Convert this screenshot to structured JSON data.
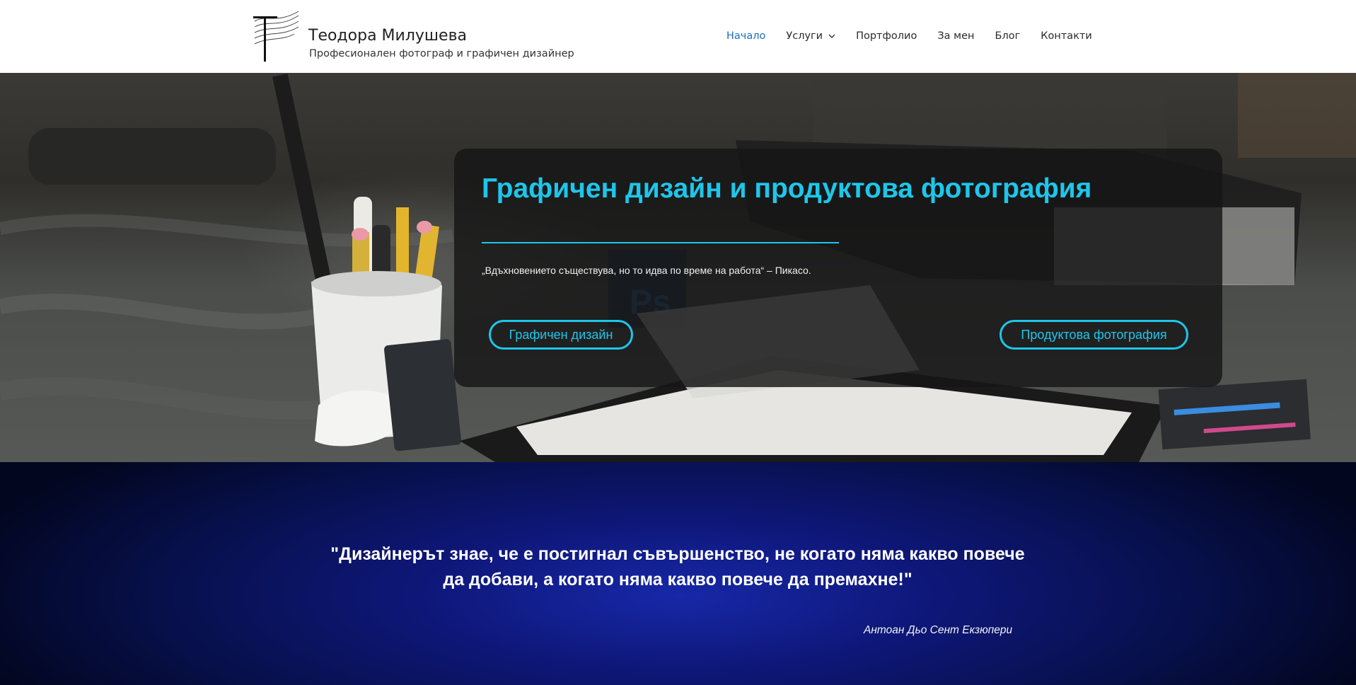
{
  "site": {
    "title": "Теодора Милушева",
    "tagline": "Професионален фотограф и графичен дизайнер"
  },
  "nav": {
    "items": [
      {
        "label": "Начало",
        "active": true
      },
      {
        "label": "Услуги",
        "has_submenu": true
      },
      {
        "label": "Портфолио"
      },
      {
        "label": "За мен"
      },
      {
        "label": "Блог"
      },
      {
        "label": "Контакти"
      }
    ]
  },
  "hero": {
    "title": "Графичен дизайн и продуктова фотография",
    "quote": "„Вдъхновението съществува, но то идва по време на работа“ – Пикасо.",
    "buttons": {
      "graphic_design": "Графичен дизайн",
      "product_photography": "Продуктова фотография"
    }
  },
  "quote_band": {
    "quote": "\"Дизайнерът знае, че е постигнал съвършенство, не когато няма какво повече да добави, а когато няма какво повече да премахне!\"",
    "author": "Антоан Дьо Сент Екзюпери"
  },
  "colors": {
    "accent": "#1ec6ea",
    "nav_active": "#1a6ec4",
    "quote_band": "#0e1778"
  },
  "icons": {
    "logo": "stylized-t-logo",
    "submenu": "chevron-down-icon"
  }
}
